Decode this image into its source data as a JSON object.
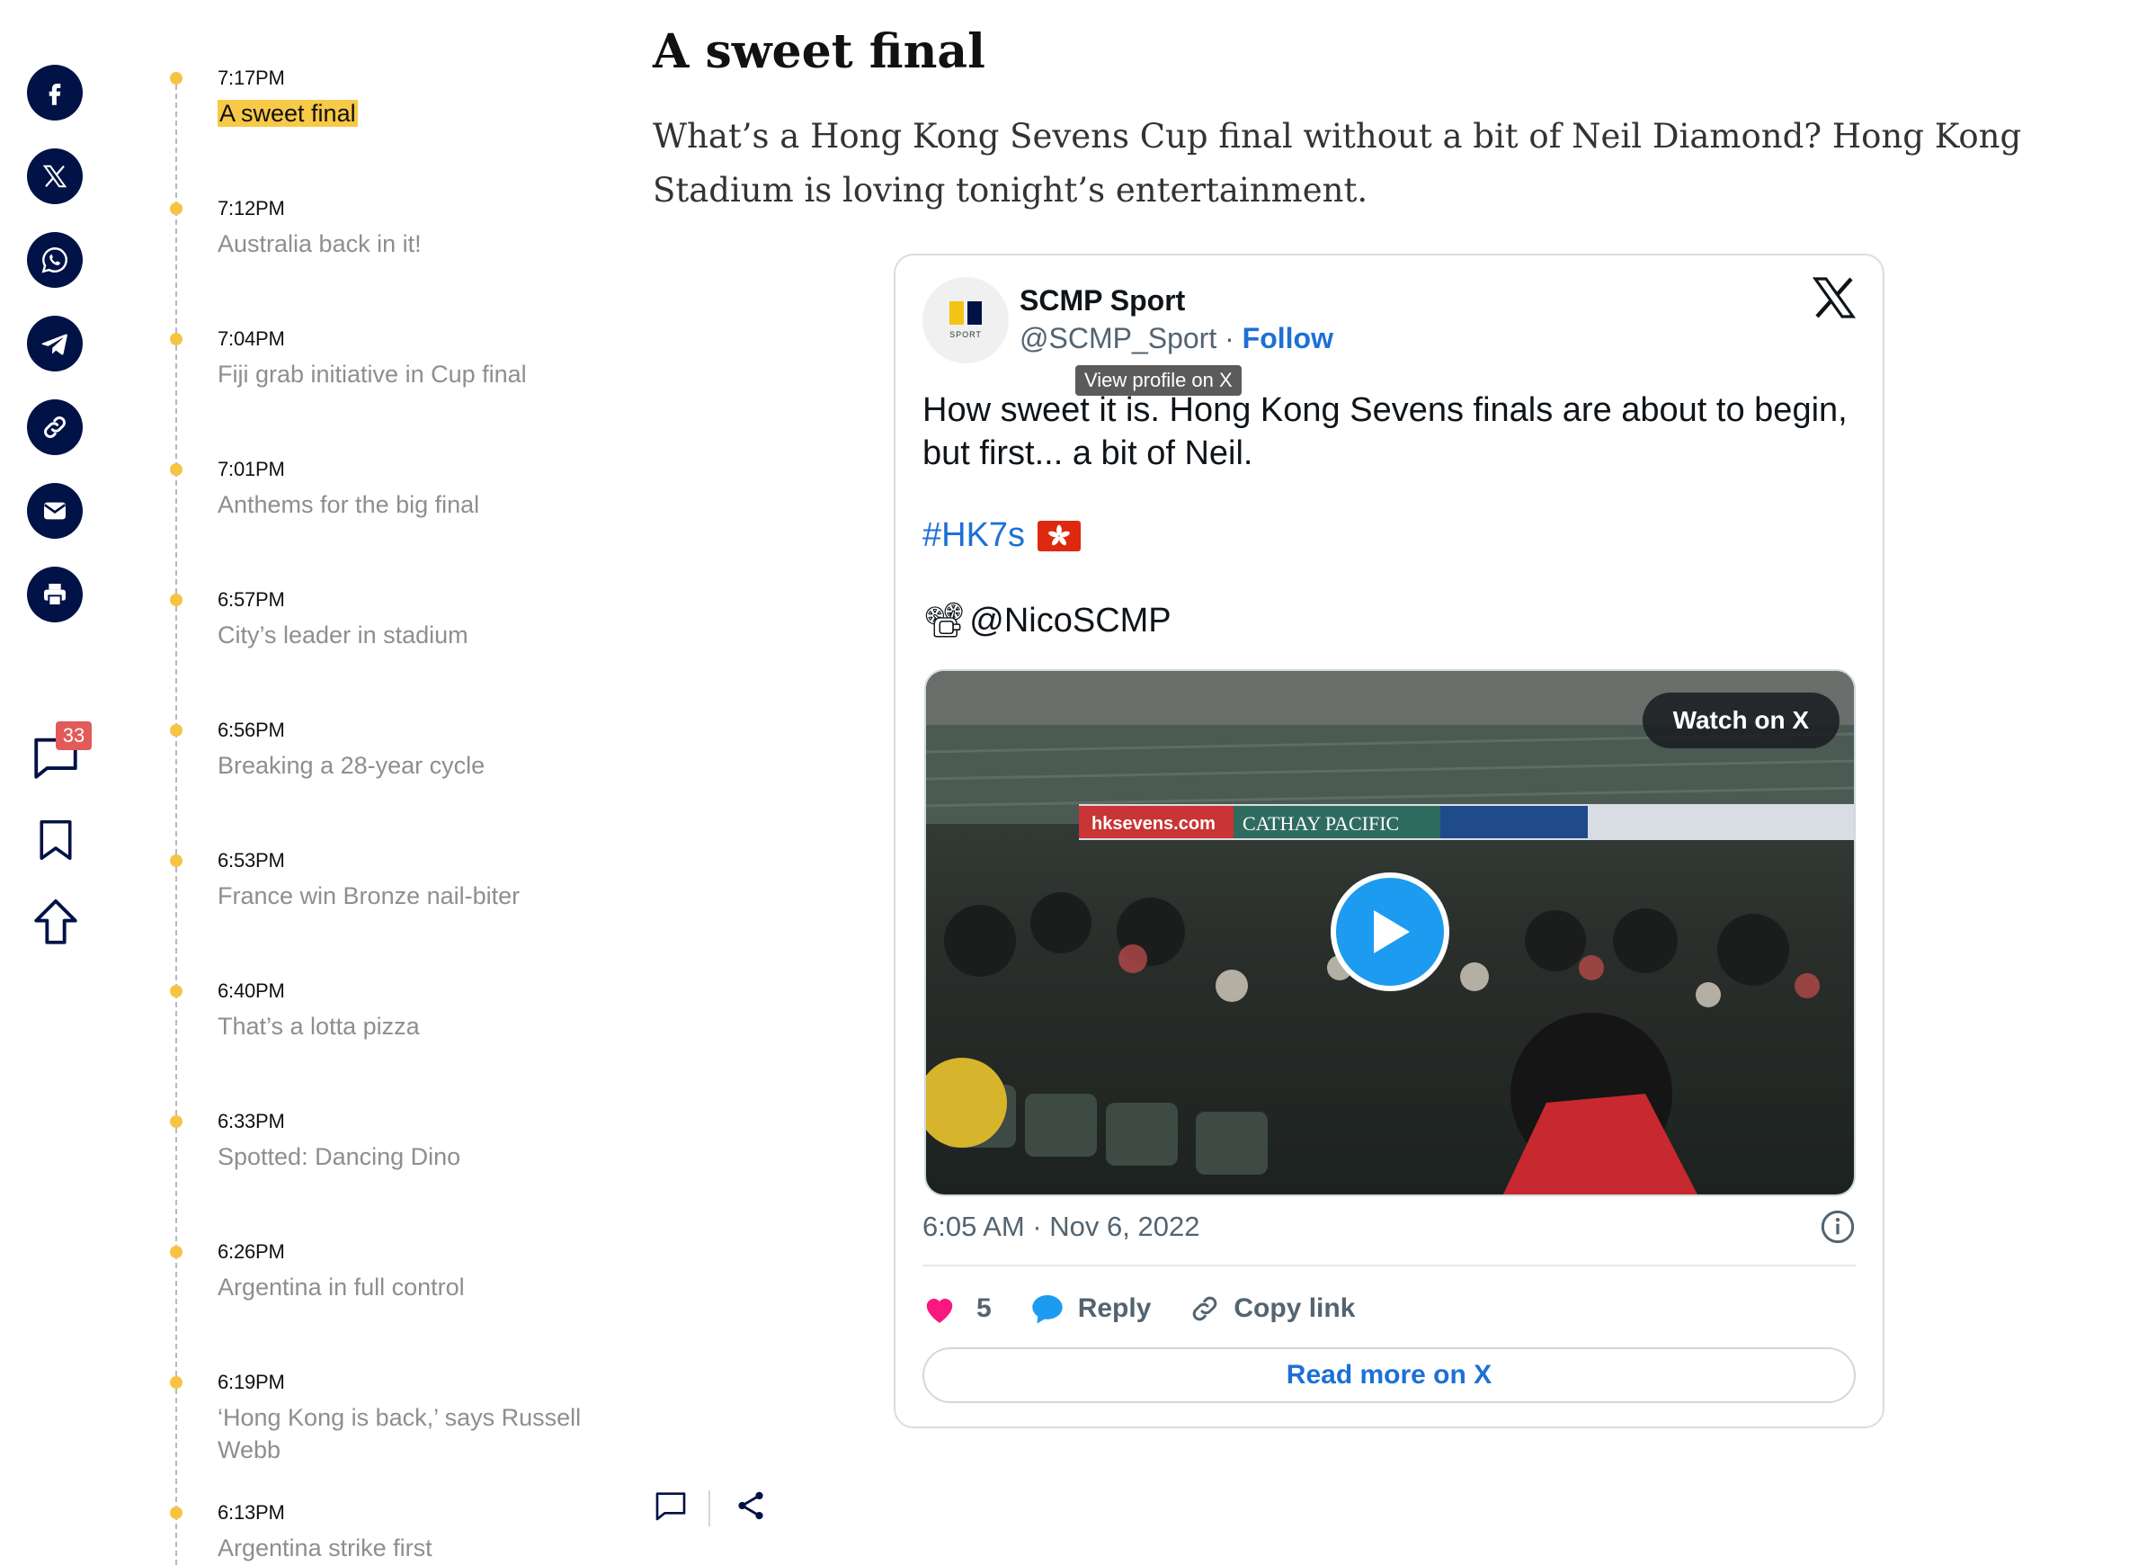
{
  "share_rail": {
    "buttons": [
      "facebook-icon",
      "x-icon",
      "whatsapp-icon",
      "telegram-icon",
      "link-icon",
      "email-icon",
      "print-icon"
    ],
    "comments_count": "33",
    "brand_color": "#001246"
  },
  "timeline": {
    "items": [
      {
        "time": "7:17PM",
        "title": "A sweet final"
      },
      {
        "time": "7:12PM",
        "title": "Australia back in it!"
      },
      {
        "time": "7:04PM",
        "title": "Fiji grab initiative in Cup final"
      },
      {
        "time": "7:01PM",
        "title": "Anthems for the big final"
      },
      {
        "time": "6:57PM",
        "title": "City’s leader in stadium"
      },
      {
        "time": "6:56PM",
        "title": "Breaking a 28-year cycle"
      },
      {
        "time": "6:53PM",
        "title": "France win Bronze nail-biter"
      },
      {
        "time": "6:40PM",
        "title": "That’s a lotta pizza"
      },
      {
        "time": "6:33PM",
        "title": "Spotted: Dancing Dino"
      },
      {
        "time": "6:26PM",
        "title": "Argentina in full control"
      },
      {
        "time": "6:19PM",
        "title": "‘Hong Kong is back,’ says Russell Webb"
      },
      {
        "time": "6:13PM",
        "title": "Argentina strike first"
      }
    ],
    "dot_color": "#f6c344",
    "highlight_color": "#f7c947"
  },
  "article": {
    "headline": "A sweet final",
    "body": "What’s a Hong Kong Sevens Cup final without a bit of Neil Diamond? Hong Kong Stadium is loving tonight’s entertainment."
  },
  "post": {
    "author_name": "SCMP Sport",
    "handle": "@SCMP_Sport",
    "separator": " · ",
    "follow_label": "Follow",
    "tooltip": "View profile on X",
    "avatar_sub": "SPORT",
    "text": "How sweet it is. Hong Kong Sevens finals are about to begin, but first... a bit of Neil.",
    "hashtag": "#HK7s",
    "credit_emoji": "📽",
    "credit": "@NicoSCMP",
    "watch_label": "Watch on X",
    "video_banners": {
      "site": "hksevens.com",
      "sponsor": "CATHAY PACIFIC"
    },
    "timestamp": "6:05 AM · Nov 6, 2022",
    "likes": "5",
    "reply_label": "Reply",
    "copy_label": "Copy link",
    "read_more_label": "Read more on X",
    "accent_color": "#1d70d6",
    "heart_color": "#f91880"
  }
}
